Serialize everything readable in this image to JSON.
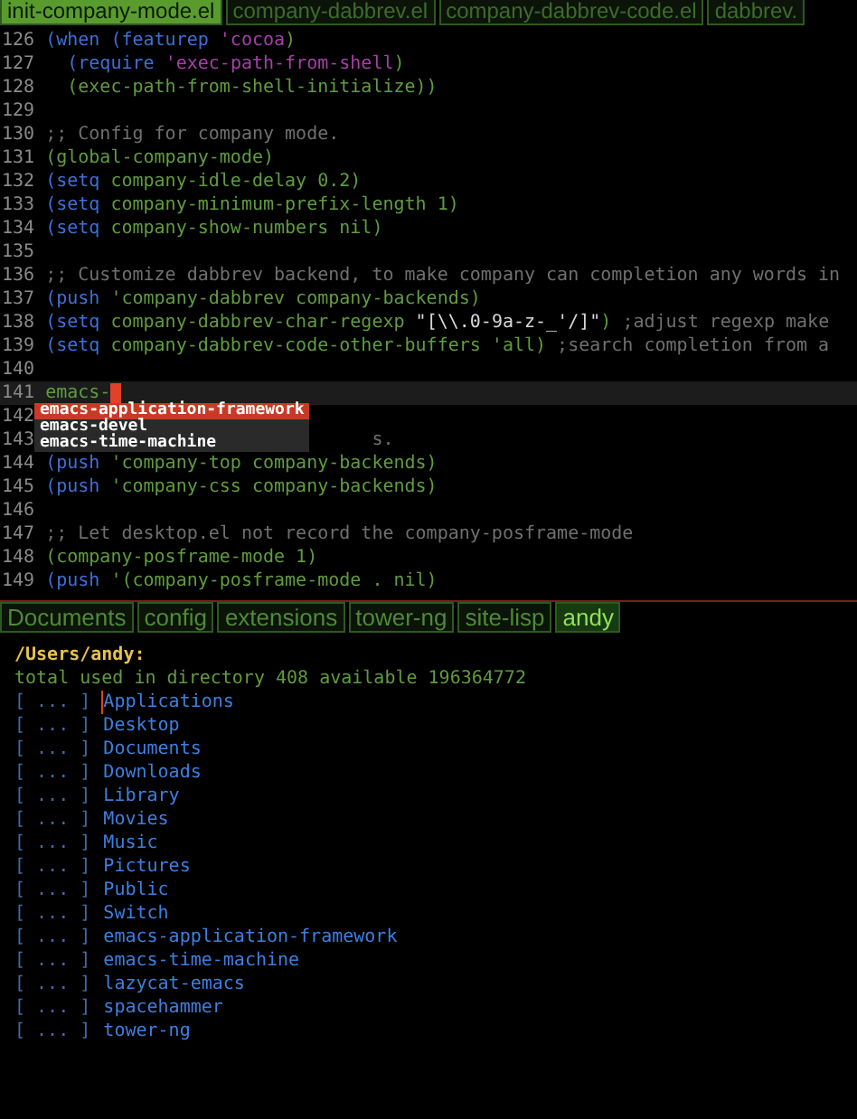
{
  "editor_tabs": [
    {
      "label": "init-company-mode.el",
      "selected": true
    },
    {
      "label": "company-dabbrev.el",
      "selected": false
    },
    {
      "label": "company-dabbrev-code.el",
      "selected": false
    },
    {
      "label": "dabbrev.",
      "selected": false
    }
  ],
  "code_lines": [
    {
      "number": "126",
      "current": false,
      "segments": [
        {
          "kind": "keyword",
          "text": "(when (featurep"
        },
        {
          "kind": "quoted",
          "text": " 'cocoa"
        },
        {
          "kind": "code",
          "text": ")"
        }
      ]
    },
    {
      "number": "127",
      "current": false,
      "segments": [
        {
          "kind": "keyword",
          "text": "  (require"
        },
        {
          "kind": "quoted",
          "text": " 'exec-path-from-shell"
        },
        {
          "kind": "code",
          "text": ")"
        }
      ]
    },
    {
      "number": "128",
      "current": false,
      "segments": [
        {
          "kind": "code",
          "text": "  (exec-path-from-shell-initialize))"
        }
      ]
    },
    {
      "number": "129",
      "current": false
    },
    {
      "number": "130",
      "current": false,
      "segments": [
        {
          "kind": "comment",
          "text": ";; Config for company mode."
        }
      ]
    },
    {
      "number": "131",
      "current": false,
      "segments": [
        {
          "kind": "code",
          "text": "(global-company-mode)"
        }
      ]
    },
    {
      "number": "132",
      "current": false,
      "segments": [
        {
          "kind": "keyword",
          "text": "(setq"
        },
        {
          "kind": "code",
          "text": " company-idle-delay 0.2)"
        }
      ]
    },
    {
      "number": "133",
      "current": false,
      "segments": [
        {
          "kind": "keyword",
          "text": "(setq"
        },
        {
          "kind": "code",
          "text": " company-minimum-prefix-length 1)"
        }
      ]
    },
    {
      "number": "134",
      "current": false,
      "segments": [
        {
          "kind": "keyword",
          "text": "(setq"
        },
        {
          "kind": "code",
          "text": " company-show-numbers nil)"
        }
      ]
    },
    {
      "number": "135",
      "current": false
    },
    {
      "number": "136",
      "current": false,
      "segments": [
        {
          "kind": "comment",
          "text": ";; Customize dabbrev backend, to make company can completion any words in"
        }
      ]
    },
    {
      "number": "137",
      "current": false,
      "segments": [
        {
          "kind": "keyword",
          "text": "(push"
        },
        {
          "kind": "code",
          "text": " 'company-dabbrev company-backends)"
        }
      ]
    },
    {
      "number": "138",
      "current": false,
      "segments": [
        {
          "kind": "keyword",
          "text": "(setq"
        },
        {
          "kind": "code",
          "text": " company-dabbrev-char-regexp "
        },
        {
          "kind": "string",
          "text": "\"[\\\\.0-9a-z-_'/]\""
        },
        {
          "kind": "code",
          "text": ")"
        },
        {
          "kind": "comment",
          "text": " ;adjust regexp make"
        }
      ]
    },
    {
      "number": "139",
      "current": false,
      "segments": [
        {
          "kind": "keyword",
          "text": "(setq"
        },
        {
          "kind": "code",
          "text": " company-dabbrev-code-other-buffers 'all)"
        },
        {
          "kind": "comment",
          "text": " ;search completion from a"
        }
      ]
    },
    {
      "number": "140",
      "current": false
    },
    {
      "number": "141",
      "current": true,
      "segments": [
        {
          "kind": "code",
          "text": "emacs-"
        }
      ]
    },
    {
      "number": "142",
      "current": false
    },
    {
      "number": "143",
      "current": false,
      "segments": [
        {
          "kind": "comment",
          "text": "s."
        }
      ]
    },
    {
      "number": "144",
      "current": false,
      "segments": [
        {
          "kind": "keyword",
          "text": "(push"
        },
        {
          "kind": "code",
          "text": " 'company-top company-backends)"
        }
      ]
    },
    {
      "number": "145",
      "current": false,
      "segments": [
        {
          "kind": "keyword",
          "text": "(push"
        },
        {
          "kind": "code",
          "text": " 'company-css company-backends)"
        }
      ]
    },
    {
      "number": "146",
      "current": false
    },
    {
      "number": "147",
      "current": false,
      "segments": [
        {
          "kind": "comment",
          "text": ";; Let desktop.el not record the company-posframe-mode"
        }
      ]
    },
    {
      "number": "148",
      "current": false,
      "segments": [
        {
          "kind": "code",
          "text": "(company-posframe-mode 1)"
        }
      ]
    },
    {
      "number": "149",
      "current": false,
      "segments": [
        {
          "kind": "keyword",
          "text": "(push"
        },
        {
          "kind": "code",
          "text": " '(company-posframe-mode . nil)"
        }
      ]
    }
  ],
  "completion": [
    {
      "label": "emacs-application-framework",
      "selected": true
    },
    {
      "label": "emacs-devel",
      "selected": false
    },
    {
      "label": "emacs-time-machine",
      "selected": false
    }
  ],
  "dired_tabs": [
    {
      "label": "Documents",
      "selected": false
    },
    {
      "label": "config",
      "selected": false
    },
    {
      "label": "extensions",
      "selected": false
    },
    {
      "label": "tower-ng",
      "selected": false
    },
    {
      "label": "site-lisp",
      "selected": false
    },
    {
      "label": "andy",
      "selected": true
    }
  ],
  "dired": {
    "path": "/Users/andy:",
    "summary": "total used in directory 408 available 196364772",
    "entries": [
      {
        "marker": "[ ... ]",
        "name": "Applications",
        "cursor": true
      },
      {
        "marker": "[ ... ]",
        "name": "Desktop",
        "cursor": false
      },
      {
        "marker": "[ ... ]",
        "name": "Documents",
        "cursor": false
      },
      {
        "marker": "[ ... ]",
        "name": "Downloads",
        "cursor": false
      },
      {
        "marker": "[ ... ]",
        "name": "Library",
        "cursor": false
      },
      {
        "marker": "[ ... ]",
        "name": "Movies",
        "cursor": false
      },
      {
        "marker": "[ ... ]",
        "name": "Music",
        "cursor": false
      },
      {
        "marker": "[ ... ]",
        "name": "Pictures",
        "cursor": false
      },
      {
        "marker": "[ ... ]",
        "name": "Public",
        "cursor": false
      },
      {
        "marker": "[ ... ]",
        "name": "Switch",
        "cursor": false
      },
      {
        "marker": "[ ... ]",
        "name": "emacs-application-framework",
        "cursor": false
      },
      {
        "marker": "[ ... ]",
        "name": "emacs-time-machine",
        "cursor": false
      },
      {
        "marker": "[ ... ]",
        "name": "lazycat-emacs",
        "cursor": false
      },
      {
        "marker": "[ ... ]",
        "name": "spacehammer",
        "cursor": false
      },
      {
        "marker": "[ ... ]",
        "name": "tower-ng",
        "cursor": false
      }
    ]
  }
}
